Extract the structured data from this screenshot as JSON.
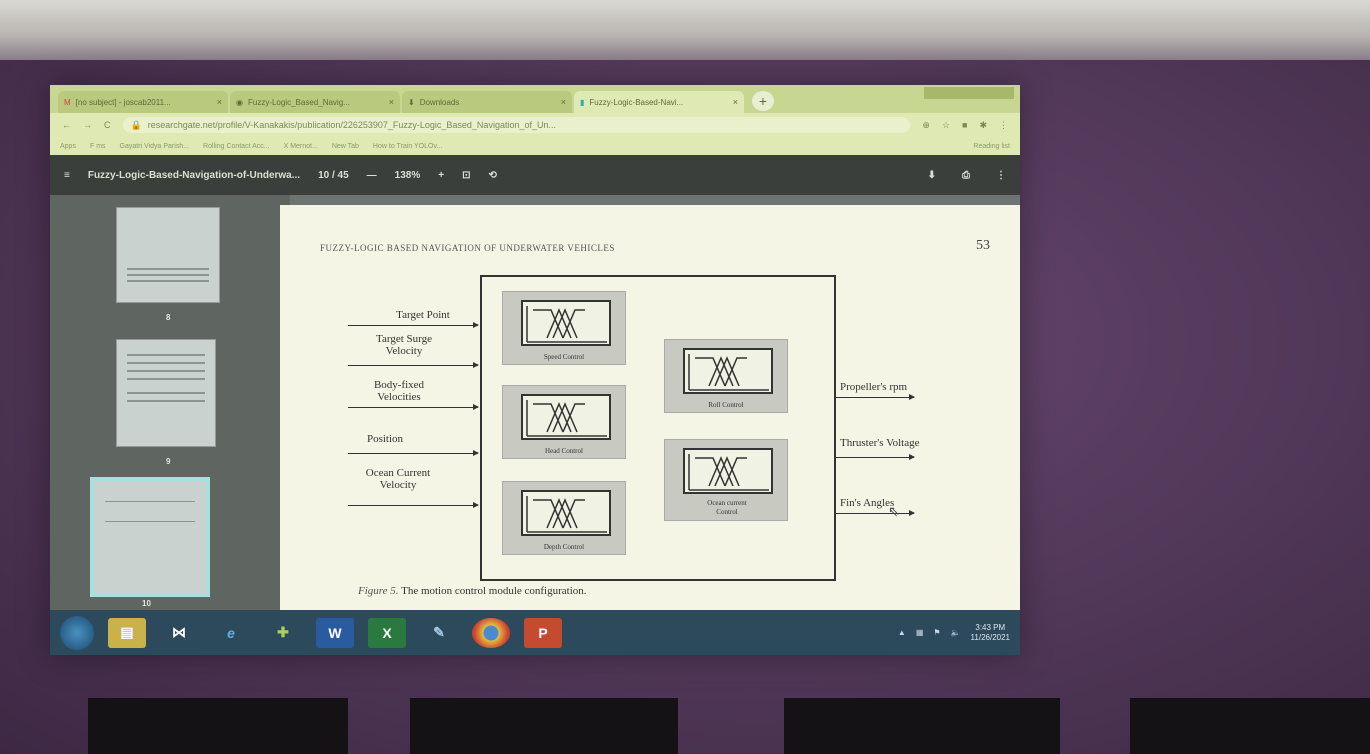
{
  "browser": {
    "tabs": [
      {
        "label": "[no subject] - joscab2011...",
        "active": false
      },
      {
        "label": "Fuzzy-Logic_Based_Navig...",
        "active": false
      },
      {
        "label": "Downloads",
        "active": false
      },
      {
        "label": "Fuzzy-Logic-Based-Navi...",
        "active": true
      }
    ],
    "url": "researchgate.net/profile/V-Kanakakis/publication/226253907_Fuzzy-Logic_Based_Navigation_of_Un...",
    "bookmarks": [
      "Apps",
      "F ms",
      "Gayatri Vidya Parish...",
      "Rolling Contact Acc...",
      "X Mernot...",
      "New Tab",
      "How to Train YOLOv..."
    ],
    "reading_list": "Reading list"
  },
  "pdf": {
    "title": "Fuzzy-Logic-Based-Navigation-of-Underwa...",
    "page_indicator": "10 / 45",
    "zoom": "138%",
    "zoom_out": "—",
    "zoom_in": "+",
    "thumbnails": [
      {
        "page": "8",
        "selected": false
      },
      {
        "page": "9",
        "selected": false
      },
      {
        "page": "10",
        "selected": true
      }
    ]
  },
  "page": {
    "running_head": "FUZZY-LOGIC BASED NAVIGATION OF UNDERWATER VEHICLES",
    "page_number": "53",
    "figure_label": "Figure 5.",
    "caption": "The motion control module configuration.",
    "inputs": [
      {
        "text": "Target Point"
      },
      {
        "text": "Target Surge Velocity"
      },
      {
        "text": "Body-fixed Velocities"
      },
      {
        "text": "Position"
      },
      {
        "text": "Ocean Current Velocity"
      }
    ],
    "outputs": [
      {
        "text": "Propeller's rpm"
      },
      {
        "text": "Thruster's Voltage"
      },
      {
        "text": "Fin's Angles"
      }
    ],
    "controls": [
      {
        "name": "Speed Control"
      },
      {
        "name": "Head Control"
      },
      {
        "name": "Depth Control"
      },
      {
        "name": "Roll Control"
      },
      {
        "name": "Ocean current Control"
      }
    ]
  },
  "taskbar": {
    "apps": [
      "explorer",
      "visual-studio",
      "internet-explorer",
      "file-manager",
      "word",
      "excel",
      "paint",
      "chrome",
      "powerpoint"
    ],
    "time": "3:43 PM",
    "date": "11/26/2021"
  },
  "colors": {
    "wall": "#553a5c",
    "chrome_tabbar": "#c7d690",
    "pdf_toolbar": "#3a3f3c",
    "page_bg": "#f4f5e4",
    "taskbar": "#2d4a5c"
  }
}
